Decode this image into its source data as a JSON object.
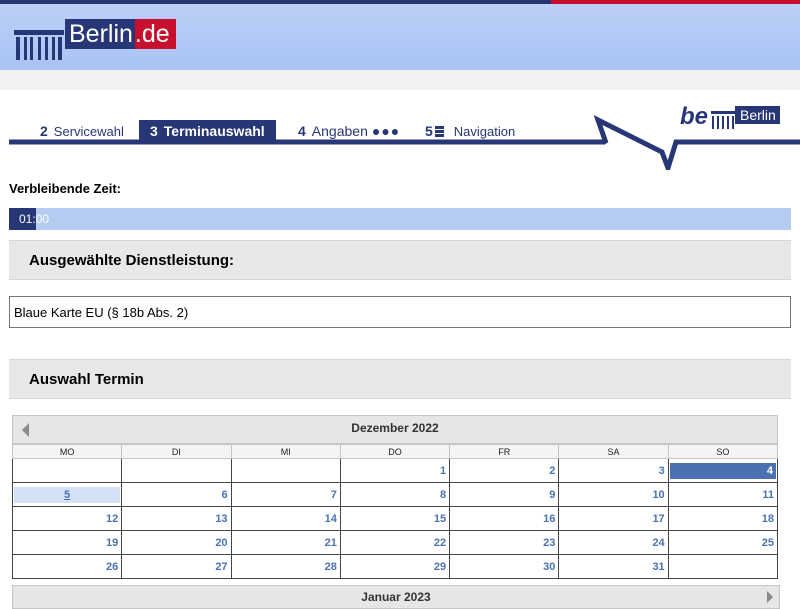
{
  "header": {
    "brand_name": "Berlin",
    "brand_tld": ".de"
  },
  "steps": [
    {
      "number": "2",
      "label": "Servicewahl"
    },
    {
      "number": "3",
      "label": "Terminauswahl",
      "active": true
    },
    {
      "number": "4",
      "label": "Angaben",
      "extra": "●●●"
    },
    {
      "number": "5",
      "label": "Navigation",
      "icon": "list-icon"
    }
  ],
  "be_logo": {
    "be": "be",
    "berlin": "Berlin"
  },
  "timer": {
    "label": "Verbleibende Zeit:",
    "time": "01:00",
    "progress_percent": 3.5
  },
  "service_section": {
    "heading": "Ausgewählte Dienstleistung:",
    "service": "Blaue Karte EU (§ 18b Abs. 2)"
  },
  "appointment_section": {
    "heading": "Auswahl Termin"
  },
  "calendar": {
    "month_title": "Dezember 2022",
    "weekdays": [
      "MO",
      "DI",
      "MI",
      "DO",
      "FR",
      "SA",
      "SO"
    ],
    "weeks": [
      [
        "",
        "",
        "",
        "1",
        "2",
        "3",
        "4"
      ],
      [
        "5",
        "6",
        "7",
        "8",
        "9",
        "10",
        "11"
      ],
      [
        "12",
        "13",
        "14",
        "15",
        "16",
        "17",
        "18"
      ],
      [
        "19",
        "20",
        "21",
        "22",
        "23",
        "24",
        "25"
      ],
      [
        "26",
        "27",
        "28",
        "29",
        "30",
        "31",
        ""
      ]
    ],
    "selected_day": "4",
    "today_day": "5",
    "next_month_title": "Januar 2023"
  },
  "colors": {
    "brand_blue": "#273677",
    "brand_red": "#c8102e",
    "header_bg": "#b1c8f5",
    "day_link": "#4a72b2"
  }
}
